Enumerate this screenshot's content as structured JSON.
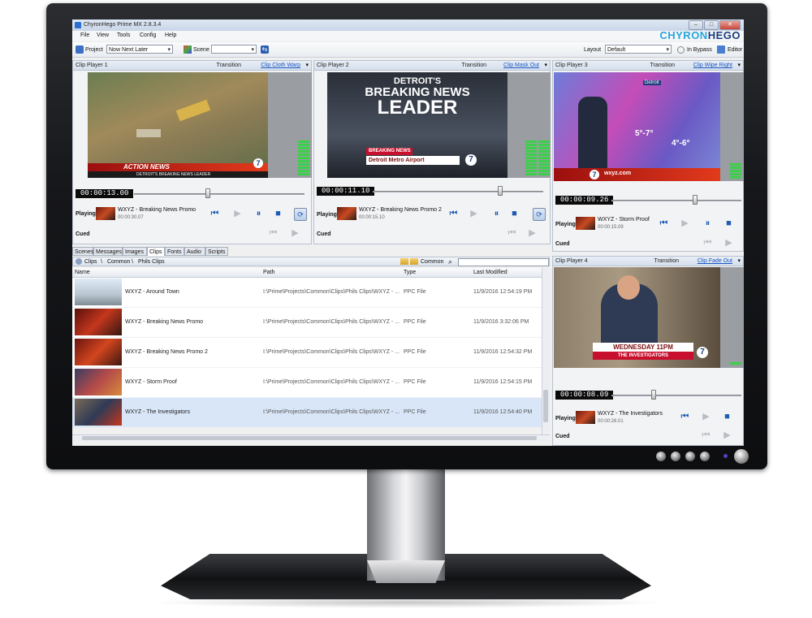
{
  "app": {
    "title": "ChyronHego Prime MX 2.8.3.4",
    "menu": [
      "File",
      "View",
      "Tools",
      "Config",
      "Help"
    ],
    "logo_part1": "CHYRON",
    "logo_part2": "HEGO"
  },
  "toolbar": {
    "project_label": "Project",
    "project_value": "Now Next Later",
    "scene_label": "Scene",
    "scene_value": "",
    "layout_label": "Layout",
    "layout_value": "Default",
    "bypass_label": "In Bypass",
    "editor_label": "Editor"
  },
  "players": [
    {
      "title": "Clip Player 1",
      "transition_label": "Transition",
      "transition": "Clip Cloth Warp",
      "timecode": "00:00:13.00",
      "playing_label": "Playing",
      "playing_clip": "WXYZ - Breaking News Promo",
      "playing_time": "00:00:30.07",
      "cued_label": "Cued"
    },
    {
      "title": "Clip Player 2",
      "transition_label": "Transition",
      "transition": "Clip Mask Out",
      "timecode": "00:00:11.10",
      "playing_label": "Playing",
      "playing_clip": "WXYZ - Breaking News Promo 2",
      "playing_time": "00:00:15.10",
      "cued_label": "Cued"
    },
    {
      "title": "Clip Player 3",
      "transition_label": "Transition",
      "transition": "Clip Wipe Right",
      "timecode": "00:00:09.26",
      "playing_label": "Playing",
      "playing_clip": "WXYZ - Storm Proof",
      "playing_time": "00:00:15.09",
      "cued_label": "Cued"
    },
    {
      "title": "Clip Player 4",
      "transition_label": "Transition",
      "transition": "Clip Fade Out",
      "timecode": "00:00:08.09",
      "playing_label": "Playing",
      "playing_clip": "WXYZ - The Investigators",
      "playing_time": "00:00:26.01",
      "cued_label": "Cued"
    }
  ],
  "video_text": {
    "p1_banner": "ACTION NEWS",
    "p1_ticker": "DETROIT'S BREAKING NEWS LEADER",
    "p1_logo": "7",
    "p2_line1": "DETROIT'S",
    "p2_line2": "BREAKING NEWS",
    "p2_line3": "LEADER",
    "p2_tag": "BREAKING NEWS",
    "p2_lower": "Detroit Metro Airport",
    "p2_logo": "7",
    "p3_site": "wxyz.com",
    "p3_temp1": "5°-7°",
    "p3_temp2": "4°-6°",
    "p3_city": "Detroit",
    "p3_logo": "7",
    "p4_line1": "WEDNESDAY 11PM",
    "p4_line2": "THE INVESTIGATORS",
    "p4_logo": "7"
  },
  "library": {
    "tabs": [
      "Scenes",
      "Messages",
      "Images",
      "Clips",
      "Fonts",
      "Audio",
      "Scripts"
    ],
    "active_tab": "Clips",
    "breadcrumb": [
      "Clips",
      "Common",
      "Phils Clips"
    ],
    "breadcrumb_sep": "\\",
    "folder_label": "Common",
    "columns": [
      "Name",
      "Path",
      "Type",
      "Last Modified"
    ],
    "rows": [
      {
        "name": "WXYZ - Around Town",
        "path": "I:\\Prime\\Projects\\Common\\Clips\\Phils Clips\\WXYZ - ...",
        "type": "PPC File",
        "modified": "11/9/2016 12:54:19 PM"
      },
      {
        "name": "WXYZ - Breaking News Promo",
        "path": "I:\\Prime\\Projects\\Common\\Clips\\Phils Clips\\WXYZ - ...",
        "type": "PPC File",
        "modified": "11/9/2016 3:32:06 PM"
      },
      {
        "name": "WXYZ - Breaking News Promo 2",
        "path": "I:\\Prime\\Projects\\Common\\Clips\\Phils Clips\\WXYZ - ...",
        "type": "PPC File",
        "modified": "11/9/2016 12:54:32 PM"
      },
      {
        "name": "WXYZ - Storm Proof",
        "path": "I:\\Prime\\Projects\\Common\\Clips\\Phils Clips\\WXYZ - ...",
        "type": "PPC File",
        "modified": "11/9/2016 12:54:15 PM"
      },
      {
        "name": "WXYZ - The Investigators",
        "path": "I:\\Prime\\Projects\\Common\\Clips\\Phils Clips\\WXYZ - ...",
        "type": "PPC File",
        "modified": "11/9/2016 12:54:40 PM"
      }
    ]
  },
  "colors": {
    "accent": "#1a56c4",
    "logo_light": "#29a4dc",
    "logo_dark": "#1d3e7c",
    "meter_green": "#3bd04a"
  }
}
